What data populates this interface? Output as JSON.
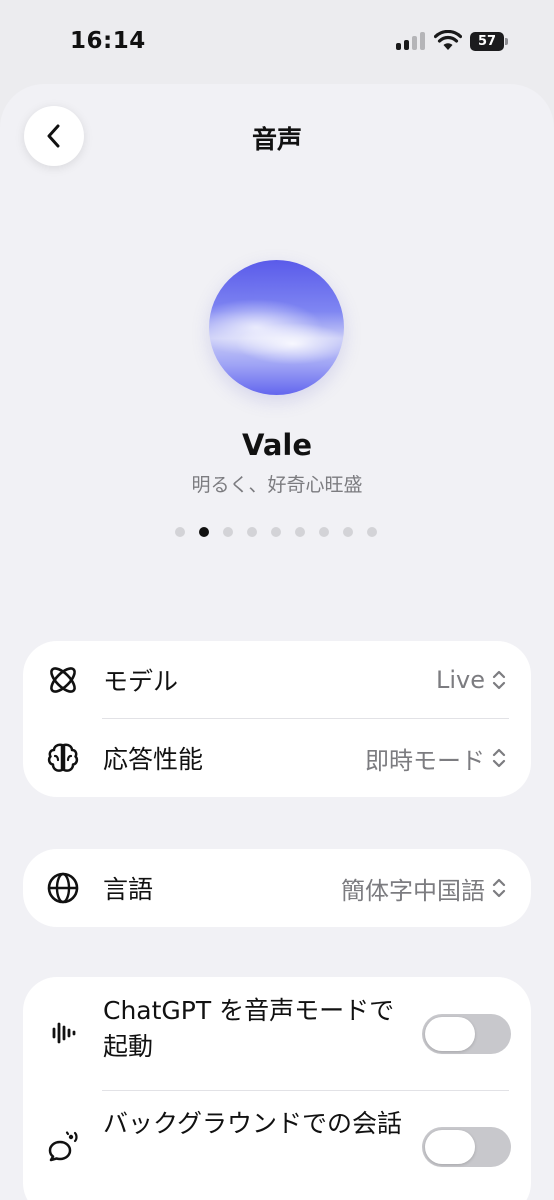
{
  "status_bar": {
    "time": "16:14",
    "battery": "57",
    "signal_bars": 4,
    "signal_bars_filled": 2
  },
  "nav": {
    "title": "音声",
    "back_icon": "chevron-left-icon"
  },
  "voice": {
    "name": "Vale",
    "description": "明るく、好奇心旺盛",
    "page_count": 9,
    "current_page": 2
  },
  "settings": {
    "model": {
      "label": "モデル",
      "value": "Live",
      "icon": "atom-icon"
    },
    "response": {
      "label": "応答性能",
      "value": "即時モード",
      "icon": "brain-icon"
    },
    "language": {
      "label": "言語",
      "value": "簡体字中国語",
      "icon": "globe-icon"
    },
    "launch_voice": {
      "label": "ChatGPT を音声モードで起動",
      "on": false,
      "icon": "waveform-icon"
    },
    "background": {
      "label": "バックグラウンドでの会話",
      "on": false,
      "icon": "chat-bubble-icon"
    }
  },
  "colors": {
    "sheet_bg": "#f1f1f5",
    "card_bg": "#ffffff",
    "secondary_text": "#7c7c80",
    "toggle_off": "#c8c8cc",
    "orb_primary": "#5a5bea"
  }
}
